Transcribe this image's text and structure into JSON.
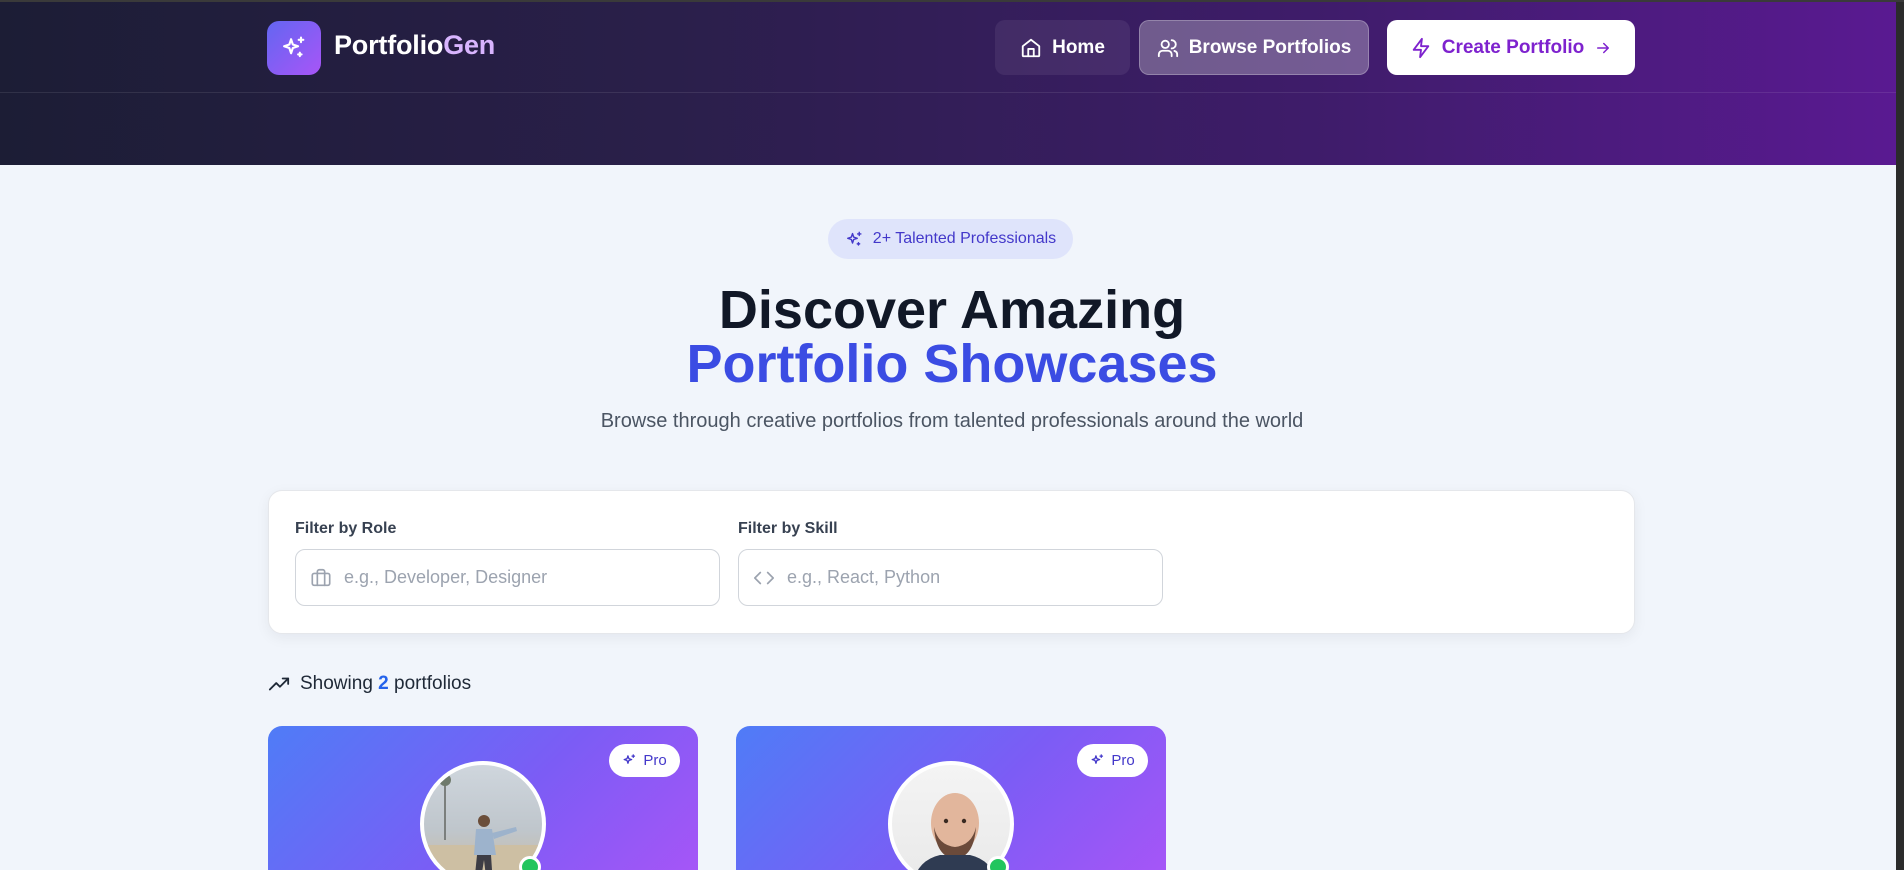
{
  "app": {
    "brand_main": "Portfolio",
    "brand_accent": "Gen",
    "logo_icon": "sparkles-icon"
  },
  "nav": {
    "home_label": "Home",
    "browse_label": "Browse Portfolios",
    "create_label": "Create Portfolio"
  },
  "hero": {
    "badge_text": "2+ Talented Professionals",
    "title_line1": "Discover Amazing",
    "title_line2": "Portfolio Showcases",
    "subtitle": "Browse through creative portfolios from talented professionals around the world"
  },
  "filters": {
    "role_label": "Filter by Role",
    "role_placeholder": "e.g., Developer, Designer",
    "role_value": "",
    "skill_label": "Filter by Skill",
    "skill_placeholder": "e.g., React, Python",
    "skill_value": ""
  },
  "results": {
    "prefix": "Showing",
    "count": "2",
    "suffix": "portfolios"
  },
  "cards": [
    {
      "badge": "Pro"
    },
    {
      "badge": "Pro"
    }
  ],
  "colors": {
    "accent_blue": "#3b4ce3",
    "accent_purple": "#7e22ce",
    "status_online": "#22c55e"
  }
}
